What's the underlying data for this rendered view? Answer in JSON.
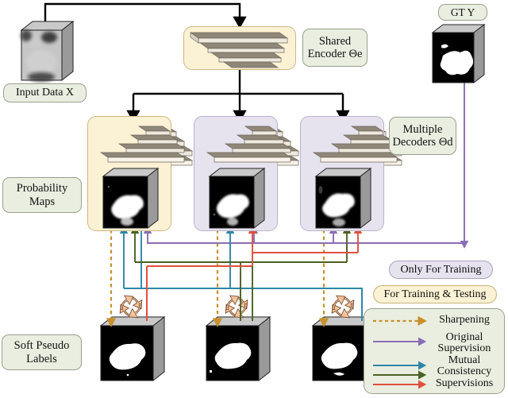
{
  "figure": {
    "domain": "diagram",
    "title": "Mutual Consistency Learning framework"
  },
  "labels": {
    "input_data": "Input Data X",
    "shared_encoder_l1": "Shared",
    "shared_encoder_l2": "Encoder Θe",
    "gt": "GT Y",
    "multiple_decoders_l1": "Multiple",
    "multiple_decoders_l2": "Decoders Θd",
    "probability_maps_l1": "Probability",
    "probability_maps_l2": "Maps",
    "soft_pseudo_l1": "Soft Pseudo",
    "soft_pseudo_l2": "Labels",
    "only_for_training": "Only For Training",
    "for_training_and_testing": "For Training & Testing"
  },
  "legend": {
    "items": [
      {
        "name": "sharpening",
        "text_lines": [
          "Sharpening"
        ],
        "color": "#c8912c",
        "style": "dashed",
        "rows": 1
      },
      {
        "name": "original-supervision",
        "text_lines": [
          "Original",
          "Supervision"
        ],
        "color": "#8a6db5",
        "style": "solid",
        "rows": 1
      },
      {
        "name": "mutual-consistency",
        "text_lines": [
          "Mutual",
          "Consistency",
          "Supervisions"
        ],
        "colors": [
          "#2e86a8",
          "#4a6123",
          "#e0503c"
        ],
        "style": "solid",
        "rows": 3
      }
    ]
  },
  "colors": {
    "sharpening": "#c8912c",
    "original_supervision": "#8a6db5",
    "mc_teal": "#2e86a8",
    "mc_green": "#4a6123",
    "mc_red": "#e0503c",
    "flow_black": "#000000",
    "pill_green": "#eaeee0",
    "panel_lavender": "#e6e3ef",
    "panel_cream": "#fbf1d4",
    "cube_top": "#c9c9c9",
    "cube_side": "#9a9a9a",
    "cycle_icon": "#f2b98a"
  },
  "structure": {
    "decoder_count": 3,
    "probability_map_count": 3,
    "pseudo_label_count": 3,
    "cycle_icon_count": 3
  }
}
